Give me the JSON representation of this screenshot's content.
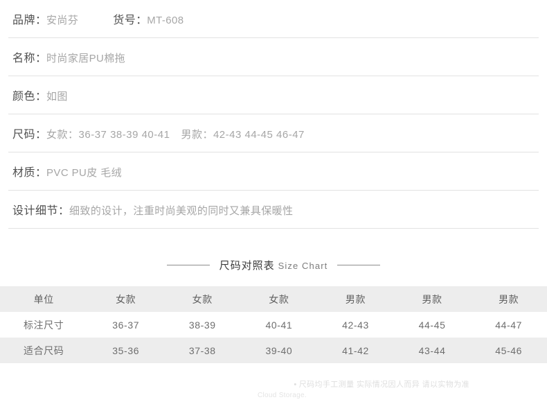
{
  "spec_rows": [
    {
      "label": "品牌",
      "colon": "：",
      "value": "安尚芬",
      "label2": "货号",
      "colon2": "：",
      "value2": "MT-608"
    },
    {
      "label": "名称",
      "colon": "：",
      "value": "时尚家居PU棉拖"
    },
    {
      "label": "颜色",
      "colon": "：",
      "value": "如图"
    },
    {
      "label": "尺码",
      "colon": "：",
      "value": "女款：36-37 38-39 40-41",
      "value_extra": "男款：42-43 44-45 46-47"
    },
    {
      "label": "材质",
      "colon": "：",
      "value": "PVC PU皮 毛绒"
    },
    {
      "label": "设计细节",
      "colon": "：",
      "value": "细致的设计，注重时尚美观的同时又兼具保暖性"
    }
  ],
  "chart": {
    "title_cn": "尺码对照表",
    "title_en": "Size Chart",
    "headers": [
      "单位",
      "女款",
      "女款",
      "女款",
      "男款",
      "男款",
      "男款"
    ],
    "rows": [
      {
        "label": "标注尺寸",
        "values": [
          "36-37",
          "38-39",
          "40-41",
          "42-43",
          "44-45",
          "44-47"
        ]
      },
      {
        "label": "适合尺码",
        "values": [
          "35-36",
          "37-38",
          "39-40",
          "41-42",
          "43-44",
          "45-46"
        ]
      }
    ]
  },
  "footer": {
    "bullet": "•",
    "note": "尺码均手工测量 实际情况因人而异 请以实物为准",
    "watermark": "Cloud Storage."
  }
}
